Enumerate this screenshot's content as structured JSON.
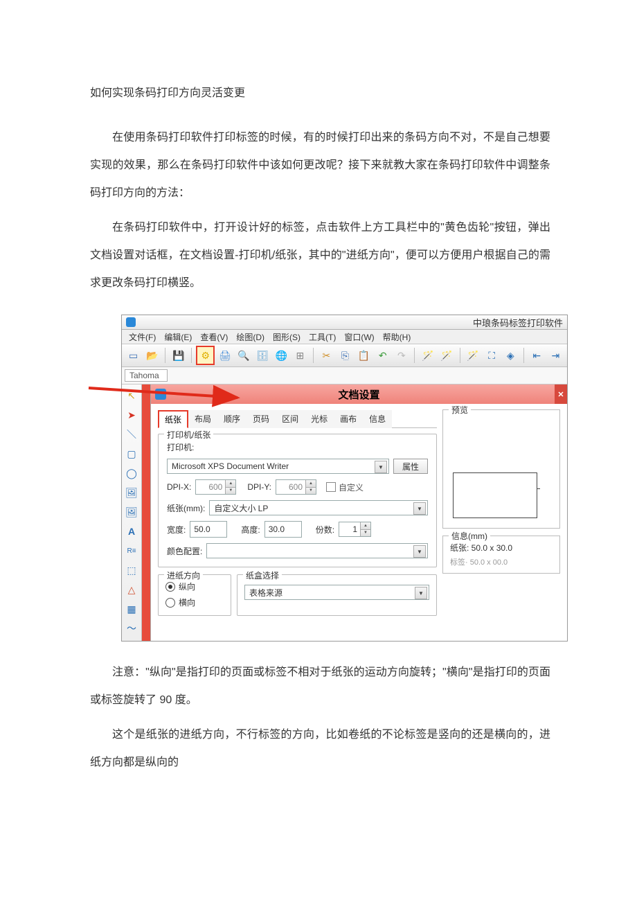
{
  "article": {
    "title": "如何实现条码打印方向灵活变更",
    "p1": "在使用条码打印软件打印标签的时候，有的时候打印出来的条码方向不对，不是自己想要实现的效果，那么在条码打印软件中该如何更改呢？接下来就教大家在条码打印软件中调整条码打印方向的方法：",
    "p2": "在条码打印软件中，打开设计好的标签，点击软件上方工具栏中的\"黄色齿轮\"按钮，弹出文档设置对话框，在文档设置-打印机/纸张，其中的\"进纸方向\"，便可以方便用户根据自己的需求更改条码打印横竖。",
    "p3": "注意：\"纵向\"是指打印的页面或标签不相对于纸张的运动方向旋转；\"横向\"是指打印的页面或标签旋转了 90 度。",
    "p4": "这个是纸张的进纸方向，不行标签的方向，比如卷纸的不论标签是竖向的还是横向的，进纸方向都是纵向的"
  },
  "app": {
    "title": "中琅条码标签打印软件",
    "font": "Tahoma",
    "menu": {
      "file": "文件(F)",
      "edit": "编辑(E)",
      "view": "查看(V)",
      "draw": "绘图(D)",
      "shape": "图形(S)",
      "tools": "工具(T)",
      "window": "窗口(W)",
      "help": "帮助(H)"
    }
  },
  "dialog": {
    "title": "文档设置",
    "tabs": {
      "paper": "纸张",
      "layout": "布局",
      "order": "顺序",
      "page": "页码",
      "section": "区间",
      "cursor": "光标",
      "canvas": "画布",
      "info": "信息"
    },
    "group1": {
      "legend": "打印机/纸张",
      "printer_label": "打印机:",
      "printer_value": "Microsoft XPS Document Writer",
      "props_btn": "属性",
      "dpix_label": "DPI-X:",
      "dpix_value": "600",
      "dpiy_label": "DPI-Y:",
      "dpiy_value": "600",
      "custom_chk": "自定义",
      "paper_label": "纸张(mm):",
      "paper_value": "自定义大小 LP",
      "width_label": "宽度:",
      "width_value": "50.0",
      "height_label": "高度:",
      "height_value": "30.0",
      "copies_label": "份数:",
      "copies_value": "1",
      "color_label": "颜色配置:"
    },
    "group2": {
      "legend": "进纸方向",
      "portrait": "纵向",
      "landscape": "横向"
    },
    "group3": {
      "legend": "纸盒选择",
      "tray_label": "表格来源"
    },
    "preview": {
      "legend": "预览"
    },
    "infobox": {
      "legend": "信息(mm)",
      "paper": "纸张:  50.0 x 30.0",
      "cutoff": "标签· 50.0 x 00.0"
    }
  }
}
